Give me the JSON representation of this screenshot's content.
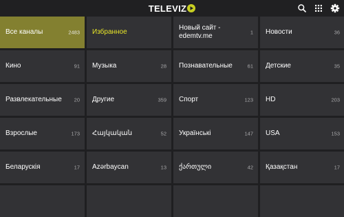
{
  "header": {
    "logo_text": "TELEVIZ",
    "accent_color": "#c8cf22",
    "icons": [
      "search-icon",
      "apps-grid-icon",
      "settings-gear-icon"
    ]
  },
  "categories": [
    {
      "name": "Все каналы",
      "count": "2483",
      "active": true,
      "highlight": false
    },
    {
      "name": "Избранное",
      "count": "",
      "active": false,
      "highlight": true
    },
    {
      "name": "Новый сайт - edemtv.me",
      "count": "1",
      "active": false,
      "highlight": false
    },
    {
      "name": "Новости",
      "count": "36",
      "active": false,
      "highlight": false
    },
    {
      "name": "Кино",
      "count": "91",
      "active": false,
      "highlight": false
    },
    {
      "name": "Музыка",
      "count": "28",
      "active": false,
      "highlight": false
    },
    {
      "name": "Познавательные",
      "count": "61",
      "active": false,
      "highlight": false
    },
    {
      "name": "Детские",
      "count": "35",
      "active": false,
      "highlight": false
    },
    {
      "name": "Развлекательные",
      "count": "20",
      "active": false,
      "highlight": false
    },
    {
      "name": "Другие",
      "count": "359",
      "active": false,
      "highlight": false
    },
    {
      "name": "Спорт",
      "count": "123",
      "active": false,
      "highlight": false
    },
    {
      "name": "HD",
      "count": "203",
      "active": false,
      "highlight": false
    },
    {
      "name": "Взрослые",
      "count": "173",
      "active": false,
      "highlight": false
    },
    {
      "name": "Հայկական",
      "count": "52",
      "active": false,
      "highlight": false
    },
    {
      "name": "Українські",
      "count": "147",
      "active": false,
      "highlight": false
    },
    {
      "name": "USA",
      "count": "153",
      "active": false,
      "highlight": false
    },
    {
      "name": "Беларускія",
      "count": "17",
      "active": false,
      "highlight": false
    },
    {
      "name": "Azərbaycan",
      "count": "13",
      "active": false,
      "highlight": false
    },
    {
      "name": "ქართული",
      "count": "42",
      "active": false,
      "highlight": false
    },
    {
      "name": "Қазақстан",
      "count": "17",
      "active": false,
      "highlight": false
    },
    {
      "name": "",
      "count": "",
      "active": false,
      "highlight": false
    },
    {
      "name": "",
      "count": "",
      "active": false,
      "highlight": false
    },
    {
      "name": "",
      "count": "",
      "active": false,
      "highlight": false
    },
    {
      "name": "",
      "count": "",
      "active": false,
      "highlight": false
    }
  ]
}
